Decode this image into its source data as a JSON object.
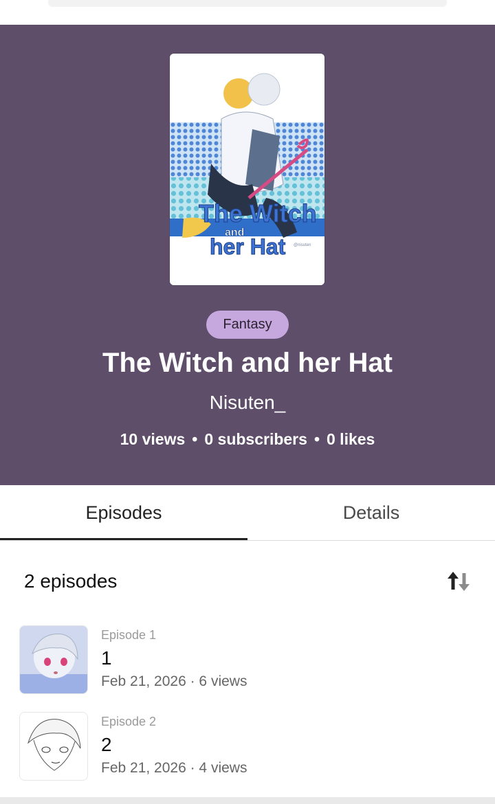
{
  "series": {
    "genre": "Fantasy",
    "title": "The Witch and her Hat",
    "author": "Nisuten_",
    "stats": {
      "views": "10 views",
      "subscribers": "0 subscribers",
      "likes": "0 likes"
    },
    "cover_lettering": {
      "line1": "The Witch",
      "line2": "and",
      "line3": "her Hat",
      "credit": "@nisuten"
    }
  },
  "tabs": [
    {
      "label": "Episodes"
    },
    {
      "label": "Details"
    }
  ],
  "episodes_header": {
    "count": "2 episodes",
    "sort_icon": "sort-arrows-icon"
  },
  "episodes": [
    {
      "number": "Episode 1",
      "title": "1",
      "meta": "Feb 21, 2026 · 6 views"
    },
    {
      "number": "Episode 2",
      "title": "2",
      "meta": "Feb 21, 2026 · 4 views"
    }
  ],
  "colors": {
    "hero_bg": "#5f4e6a",
    "genre_pill": "#c6a7de",
    "active_tab_underline": "#222222"
  }
}
